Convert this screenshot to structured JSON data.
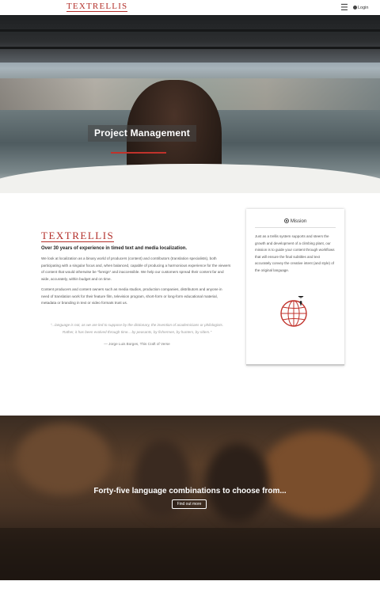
{
  "header": {
    "logo": "TEXTRELLIS",
    "menu_icon": "hamburger-icon",
    "login_label": "Login",
    "login_icon": "user-icon"
  },
  "hero": {
    "title": "Project Management",
    "accent_color": "#c0322b"
  },
  "content": {
    "logo": "TEXTRELLIS",
    "subhead": "Over 30 years of experience in timed text and media localization.",
    "paragraph1": "We look at localization as a binary world of producers (content) and contributors (translation specialists), both participating with a singular focus and, when balanced, capable of producing a harmonious experience for the viewers of content that would otherwise be “foreign” and inaccessible. We help our customers spread their content far and wide, accurately, within budget and on time.",
    "paragraph2": "Content producers and content owners such as media studios, production companies, distributors and anyone in need of translation work for their feature film, television program, short-form or long-form educational material, metadata or branding in text or video formats trust us.",
    "quote": "“...language is not, as we are led to suppose by the dictionary, the invention of academicians or philologists. Rather, it has been evolved through time... by peasants, by fishermen, by hunters, by riders.”",
    "quote_author": "— Jorge Luis Borges, This Craft of Verse"
  },
  "mission": {
    "title": "Mission",
    "icon": "target-icon",
    "text": "Just as a trellis system supports and steers the growth and development of a climbing plant, our mission is to guide your content through workflows that will ensure the final subtitles and text accurately convey the creative intent (and style) of the original language.",
    "image_icon": "globe-pin-icon"
  },
  "banner": {
    "title": "Forty-five language combinations to choose from...",
    "button_label": "Find out more"
  },
  "colors": {
    "brand_red": "#b3302b",
    "text_dark": "#222222",
    "text_muted": "#555555"
  }
}
